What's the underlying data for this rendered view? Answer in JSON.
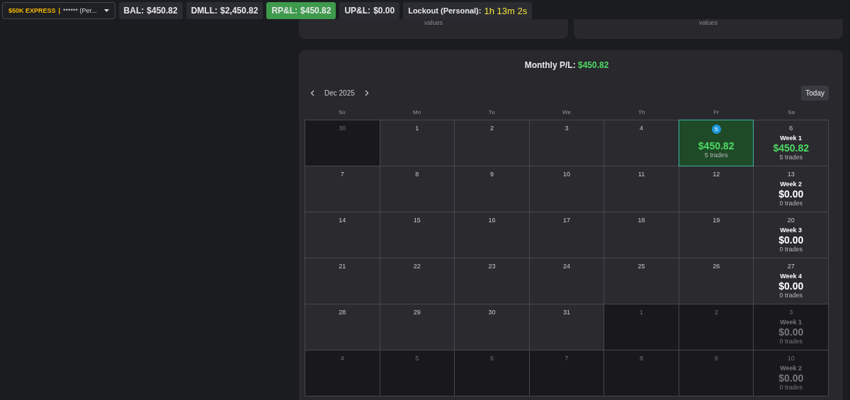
{
  "account_selector": {
    "label": "$50K EXPRESS",
    "separator": "|",
    "account": "****** (Per..."
  },
  "stats": [
    {
      "label": "BAL:",
      "value": "$450.82",
      "kind": "plain"
    },
    {
      "label": "DMLL:",
      "value": "$2,450.82",
      "kind": "plain"
    },
    {
      "label": "RP&L:",
      "value": "$450.82",
      "kind": "highlight"
    },
    {
      "label": "UP&L:",
      "value": "$0.00",
      "kind": "plain"
    },
    {
      "label": "Lockout (Personal):",
      "value": "1h 13m 2s",
      "kind": "timer"
    }
  ],
  "summary_cards": [
    {
      "caption": "values"
    },
    {
      "caption": "values"
    }
  ],
  "calendar": {
    "title": "Monthly P/L:",
    "total": "$450.82",
    "month": "Dec 2025",
    "today_button": "Today",
    "weekdays": [
      "Su",
      "Mo",
      "Tu",
      "We",
      "Th",
      "Fr",
      "Sa"
    ],
    "weeks": [
      [
        {
          "kind": "day",
          "day": "30",
          "outside": true,
          "today": false
        },
        {
          "kind": "day",
          "day": "1",
          "outside": false,
          "today": false
        },
        {
          "kind": "day",
          "day": "2",
          "outside": false,
          "today": false
        },
        {
          "kind": "day",
          "day": "3",
          "outside": false,
          "today": false
        },
        {
          "kind": "day",
          "day": "4",
          "outside": false,
          "today": false
        },
        {
          "kind": "trade",
          "day": "5",
          "outside": false,
          "today": true,
          "amount": "$450.82",
          "profit": true,
          "trades": "5 trades"
        },
        {
          "kind": "week",
          "day": "6",
          "outside": false,
          "today": false,
          "week": "Week 1",
          "amount": "$450.82",
          "profit": true,
          "trades": "5 trades"
        }
      ],
      [
        {
          "kind": "day",
          "day": "7",
          "outside": false,
          "today": false
        },
        {
          "kind": "day",
          "day": "8",
          "outside": false,
          "today": false
        },
        {
          "kind": "day",
          "day": "9",
          "outside": false,
          "today": false
        },
        {
          "kind": "day",
          "day": "10",
          "outside": false,
          "today": false
        },
        {
          "kind": "day",
          "day": "11",
          "outside": false,
          "today": false
        },
        {
          "kind": "day",
          "day": "12",
          "outside": false,
          "today": false
        },
        {
          "kind": "week",
          "day": "13",
          "outside": false,
          "today": false,
          "week": "Week 2",
          "amount": "$0.00",
          "profit": false,
          "trades": "0 trades"
        }
      ],
      [
        {
          "kind": "day",
          "day": "14",
          "outside": false,
          "today": false
        },
        {
          "kind": "day",
          "day": "15",
          "outside": false,
          "today": false
        },
        {
          "kind": "day",
          "day": "16",
          "outside": false,
          "today": false
        },
        {
          "kind": "day",
          "day": "17",
          "outside": false,
          "today": false
        },
        {
          "kind": "day",
          "day": "18",
          "outside": false,
          "today": false
        },
        {
          "kind": "day",
          "day": "19",
          "outside": false,
          "today": false
        },
        {
          "kind": "week",
          "day": "20",
          "outside": false,
          "today": false,
          "week": "Week 3",
          "amount": "$0.00",
          "profit": false,
          "trades": "0 trades"
        }
      ],
      [
        {
          "kind": "day",
          "day": "21",
          "outside": false,
          "today": false
        },
        {
          "kind": "day",
          "day": "22",
          "outside": false,
          "today": false
        },
        {
          "kind": "day",
          "day": "23",
          "outside": false,
          "today": false
        },
        {
          "kind": "day",
          "day": "24",
          "outside": false,
          "today": false
        },
        {
          "kind": "day",
          "day": "25",
          "outside": false,
          "today": false
        },
        {
          "kind": "day",
          "day": "26",
          "outside": false,
          "today": false
        },
        {
          "kind": "week",
          "day": "27",
          "outside": false,
          "today": false,
          "week": "Week 4",
          "amount": "$0.00",
          "profit": false,
          "trades": "0 trades"
        }
      ],
      [
        {
          "kind": "day",
          "day": "28",
          "outside": false,
          "today": false
        },
        {
          "kind": "day",
          "day": "29",
          "outside": false,
          "today": false
        },
        {
          "kind": "day",
          "day": "30",
          "outside": false,
          "today": false
        },
        {
          "kind": "day",
          "day": "31",
          "outside": false,
          "today": false
        },
        {
          "kind": "day",
          "day": "1",
          "outside": true,
          "today": false
        },
        {
          "kind": "day",
          "day": "2",
          "outside": true,
          "today": false
        },
        {
          "kind": "week",
          "day": "3",
          "outside": true,
          "today": false,
          "week": "Week 1",
          "amount": "$0.00",
          "profit": false,
          "trades": "0 trades"
        }
      ],
      [
        {
          "kind": "day",
          "day": "4",
          "outside": true,
          "today": false
        },
        {
          "kind": "day",
          "day": "5",
          "outside": true,
          "today": false
        },
        {
          "kind": "day",
          "day": "6",
          "outside": true,
          "today": false
        },
        {
          "kind": "day",
          "day": "7",
          "outside": true,
          "today": false
        },
        {
          "kind": "day",
          "day": "8",
          "outside": true,
          "today": false
        },
        {
          "kind": "day",
          "day": "9",
          "outside": true,
          "today": false
        },
        {
          "kind": "week",
          "day": "10",
          "outside": true,
          "today": false,
          "week": "Week 2",
          "amount": "$0.00",
          "profit": false,
          "trades": "0 trades"
        }
      ]
    ]
  }
}
